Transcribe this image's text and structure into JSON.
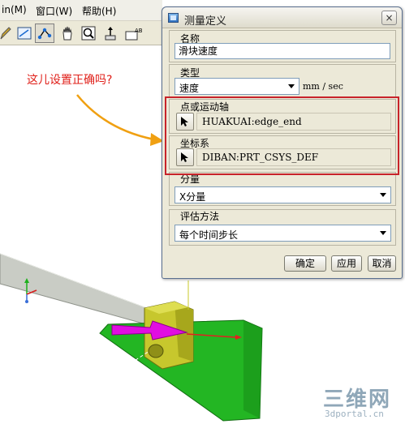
{
  "menubar": {
    "items": [
      "in(M)",
      "窗口(W)",
      "帮助(H)"
    ]
  },
  "toolbar": {
    "buttons": [
      "pencil-icon",
      "view-icon",
      "node-select-icon",
      "pan-hand-icon",
      "zoom-icon",
      "move-icon",
      "text-icon"
    ]
  },
  "annotation": {
    "text": "这儿设置正确吗?"
  },
  "dialog": {
    "title": "测量定义",
    "close_label": "×",
    "name_label": "名称",
    "name_value": "滑块速度",
    "type_label": "类型",
    "type_value": "速度",
    "type_unit": "mm / sec",
    "point_label": "点或运动轴",
    "point_value": "HUAKUAI:edge_end",
    "csys_label": "坐标系",
    "csys_value": "DIBAN:PRT_CSYS_DEF",
    "component_label": "分量",
    "component_value": "X分量",
    "eval_label": "评估方法",
    "eval_value": "每个时间步长",
    "buttons": {
      "ok": "确定",
      "apply": "应用",
      "cancel": "取消"
    }
  },
  "watermark": {
    "main": "三维网",
    "sub": "3dportal.cn"
  },
  "colors": {
    "annotation": "#e0201a",
    "highlight": "#c8232a",
    "base_plate": "#2ec12e",
    "slider": "#c8c828",
    "arrow": "#e60ae6",
    "beam": "#c8cbc4"
  }
}
